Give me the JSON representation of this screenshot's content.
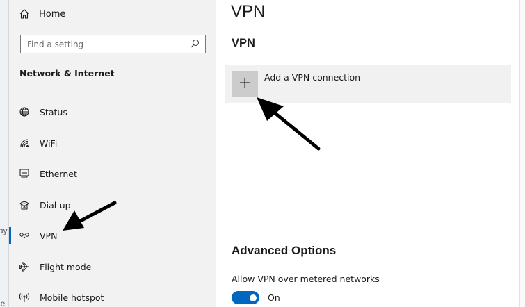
{
  "desktop_fragments": [
    "ay",
    "le"
  ],
  "sidebar": {
    "home_label": "Home",
    "search_placeholder": "Find a setting",
    "section_title": "Network & Internet",
    "items": [
      {
        "label": "Status",
        "icon": "globe-icon"
      },
      {
        "label": "WiFi",
        "icon": "wifi-icon"
      },
      {
        "label": "Ethernet",
        "icon": "ethernet-icon"
      },
      {
        "label": "Dial-up",
        "icon": "dialup-icon"
      },
      {
        "label": "VPN",
        "icon": "vpn-icon",
        "active": true
      },
      {
        "label": "Flight mode",
        "icon": "airplane-icon"
      },
      {
        "label": "Mobile hotspot",
        "icon": "hotspot-icon"
      }
    ]
  },
  "main": {
    "page_title": "VPN",
    "section_title": "VPN",
    "add_label": "Add a VPN connection",
    "advanced_title": "Advanced Options",
    "metered_label": "Allow VPN over metered networks",
    "metered_state": "On"
  },
  "colors": {
    "accent": "#0067c0",
    "sidebar_bg": "#f2f2f2",
    "tile_bg": "#cccccc"
  }
}
